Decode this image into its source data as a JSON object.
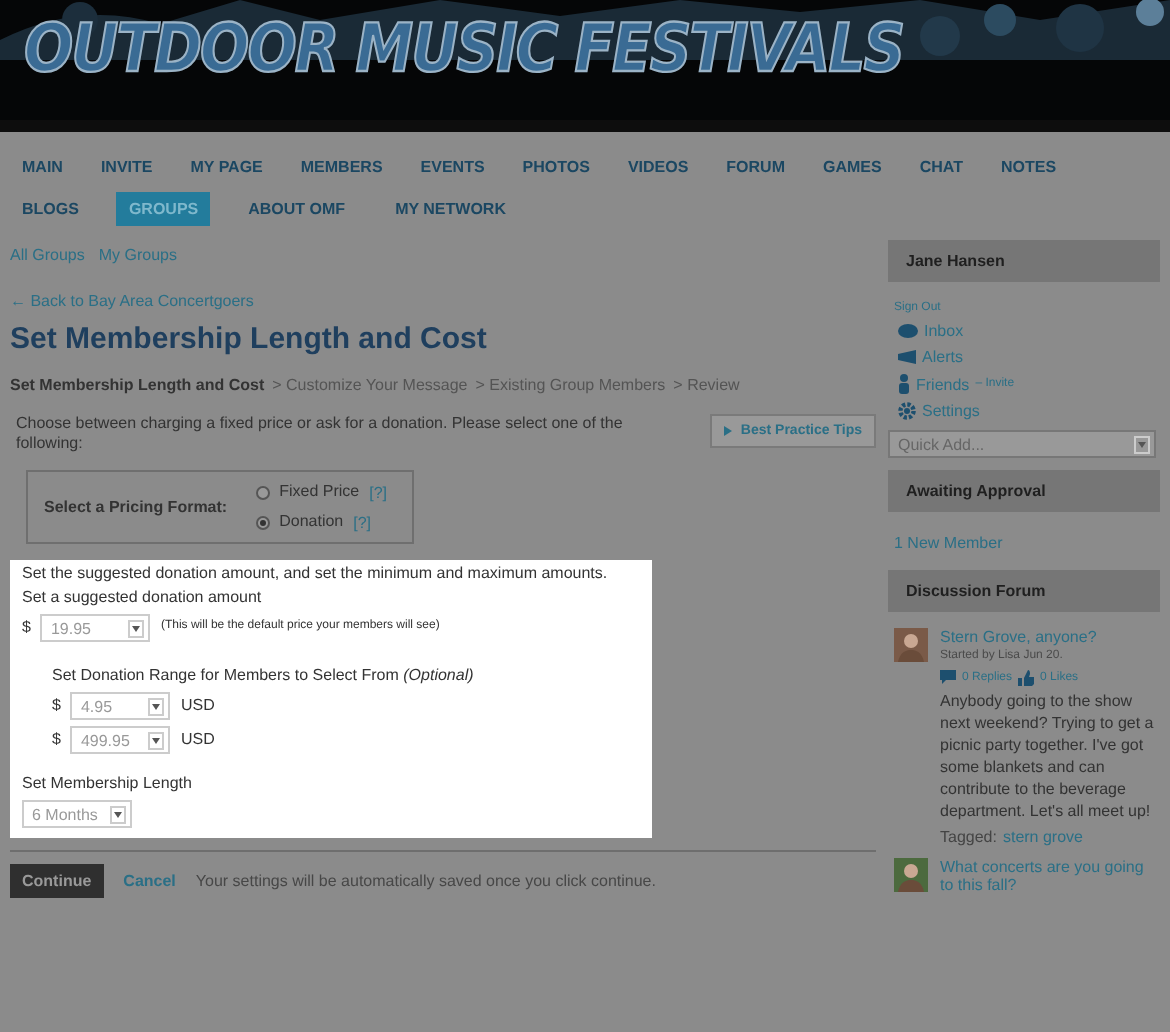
{
  "site_title": "OUTDOOR MUSIC FESTIVALS",
  "nav": [
    {
      "label": "MAIN",
      "selected": false
    },
    {
      "label": "INVITE",
      "selected": false
    },
    {
      "label": "MY PAGE",
      "selected": false
    },
    {
      "label": "MEMBERS",
      "selected": false
    },
    {
      "label": "EVENTS",
      "selected": false
    },
    {
      "label": "PHOTOS",
      "selected": false
    },
    {
      "label": "VIDEOS",
      "selected": false
    },
    {
      "label": "FORUM",
      "selected": false
    },
    {
      "label": "GAMES",
      "selected": false
    },
    {
      "label": "CHAT",
      "selected": false
    },
    {
      "label": "NOTES",
      "selected": false
    },
    {
      "label": "BLOGS",
      "selected": false
    },
    {
      "label": "GROUPS",
      "selected": true
    },
    {
      "label": "ABOUT OMF",
      "selected": false
    },
    {
      "label": "MY NETWORK",
      "selected": false
    }
  ],
  "sub_links": [
    "All Groups",
    "My Groups"
  ],
  "back_link": "← Back to Bay Area Concertgoers",
  "page_title": "Set Membership Length and Cost",
  "steps": [
    {
      "label": "Set Membership Length and Cost",
      "selected": true
    },
    {
      "label": "> Customize Your Message",
      "selected": false
    },
    {
      "label": "> Existing Group Members",
      "selected": false
    },
    {
      "label": "> Review",
      "selected": false
    }
  ],
  "intro": "Choose between charging a fixed price or ask for a donation. Please select one of the following:",
  "tips_button": "Best Practice Tips",
  "pricing": {
    "label": "Select a Pricing Format:",
    "options": [
      {
        "label": "Fixed Price",
        "help": "[?]",
        "selected": false
      },
      {
        "label": "Donation",
        "help": "[?]",
        "selected": true
      }
    ]
  },
  "donation": {
    "intro": "Set the suggested donation amount, and set the minimum and maximum amounts.",
    "suggested_label": "Set a suggested donation amount",
    "suggested": {
      "currency": "$",
      "value": "19.95",
      "note": "(This will be the default price your members will see)"
    },
    "range_label": "Set Donation Range for Members to Select From *(Optional)*",
    "range": [
      {
        "currency": "$",
        "value": "4.95",
        "unit": "USD"
      },
      {
        "currency": "$",
        "value": "499.95",
        "unit": "USD"
      }
    ],
    "length_label": "Set Membership Length",
    "length": "6 Months"
  },
  "actions": {
    "continue": "Continue",
    "cancel": "Cancel",
    "note": "Your settings will be automatically saved once you click continue."
  },
  "sidebar": {
    "user": "Jane Hansen",
    "sign_out": "Sign Out",
    "links": [
      {
        "kind": "inbox",
        "label": "Inbox"
      },
      {
        "kind": "alerts",
        "label": "Alerts"
      },
      {
        "kind": "friends",
        "label": "Friends",
        "extra": "– Invite"
      },
      {
        "kind": "settings",
        "label": "Settings"
      }
    ],
    "quick_add": "Quick Add...",
    "awaiting_title": "Awaiting Approval",
    "awaiting_link": "1 New Member",
    "forum_title": "Discussion Forum",
    "posts": [
      {
        "title": "Stern Grove, anyone?",
        "meta": "Started by Lisa Jun 20.",
        "replies": "0 Replies",
        "likes": "0 Likes",
        "body": "Anybody going to the show next weekend? Trying to get a picnic party together. I've got some blankets and can contribute to the beverage department. Let's all meet up!",
        "tagged_label": "Tagged:",
        "tag": "stern grove"
      },
      {
        "title": "What concerts are you going to this fall?"
      }
    ]
  }
}
